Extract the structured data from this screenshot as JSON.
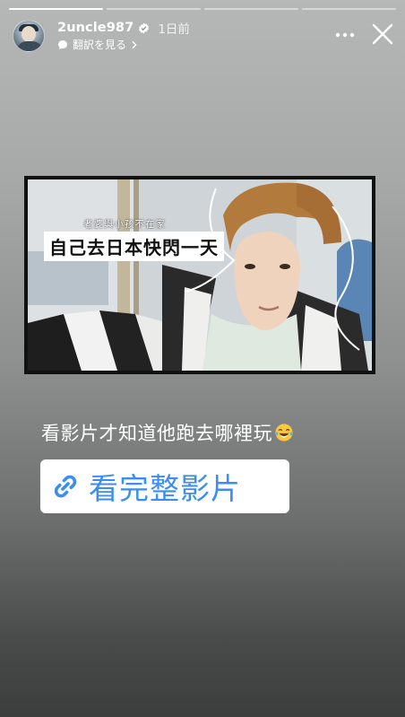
{
  "story": {
    "progress": {
      "segments": 4,
      "active_index": 0
    }
  },
  "header": {
    "username": "2uncle987",
    "time": "1日前",
    "translate_label": "翻訳を見る"
  },
  "video_thumbnail": {
    "caption_small": "老婆與小孩不在家",
    "caption_big": "自己去日本快閃一天"
  },
  "headline": "看影片才知道他跑去哪裡玩",
  "link_sticker": {
    "label": "看完整影片"
  },
  "colors": {
    "link_blue": "#3b8ef0",
    "verified_blue": "#3897f0"
  }
}
